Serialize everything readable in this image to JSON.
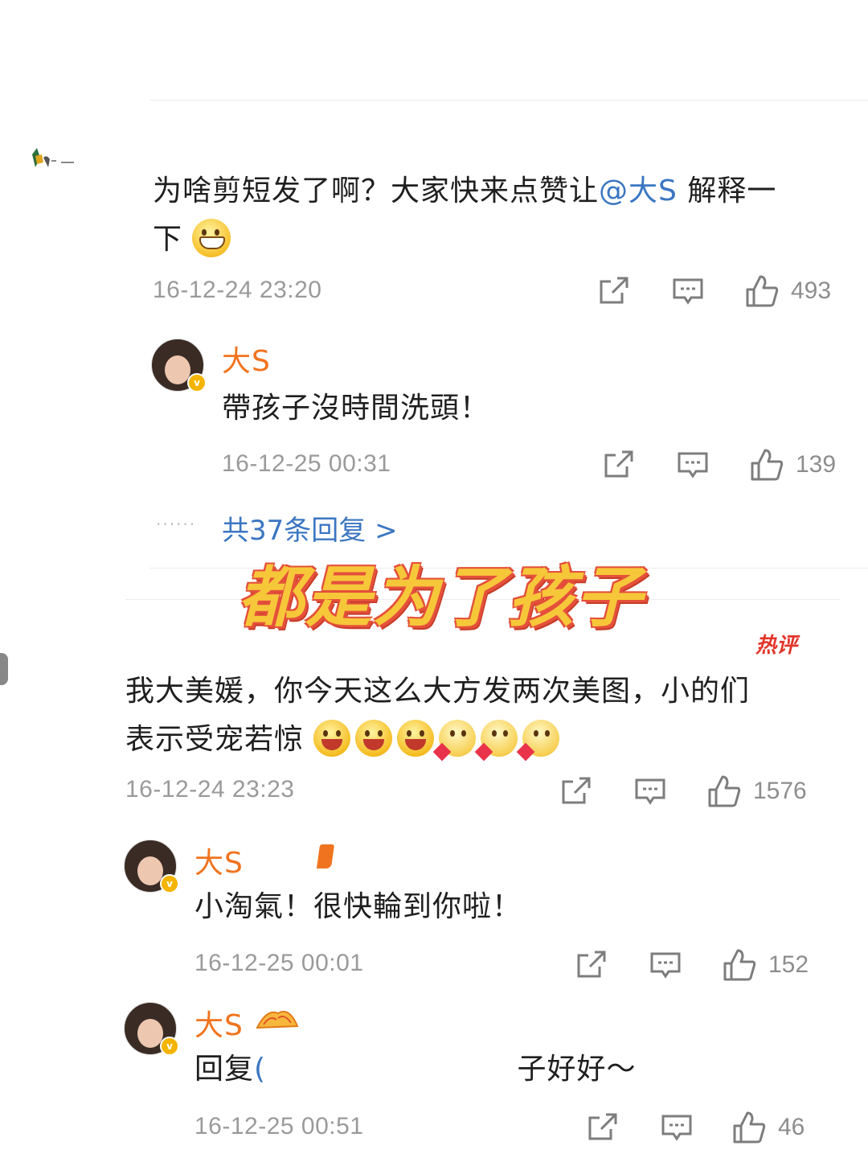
{
  "comment1": {
    "text": "为啥剪短发了啊？大家快来点赞让",
    "mention": "@大S",
    "text_after": "解释一",
    "text_line2": "下",
    "timestamp": "16-12-24 23:20",
    "likes": "493",
    "reply": {
      "name": "大S",
      "text": "帶孩子沒時間洗頭！",
      "timestamp": "16-12-25 00:31",
      "likes": "139"
    },
    "more_replies": "共37条回复 >"
  },
  "banner": "都是为了孩子",
  "hot_badge": "热评",
  "comment2": {
    "text_line1": "我大美媛，你今天这么大方发两次美图，小的们",
    "text_line2": "表示受宠若惊",
    "timestamp": "16-12-24 23:23",
    "likes": "1576",
    "replies": [
      {
        "name": "大S",
        "text": "小淘氣！很快輪到你啦！",
        "timestamp": "16-12-25 00:01",
        "likes": "152"
      },
      {
        "name": "大S",
        "text_start": "回复",
        "text_end": "子好好～",
        "timestamp": "16-12-25 00:51",
        "likes": "46"
      }
    ]
  },
  "icons": [
    "share-icon",
    "comment-icon",
    "like-icon"
  ]
}
